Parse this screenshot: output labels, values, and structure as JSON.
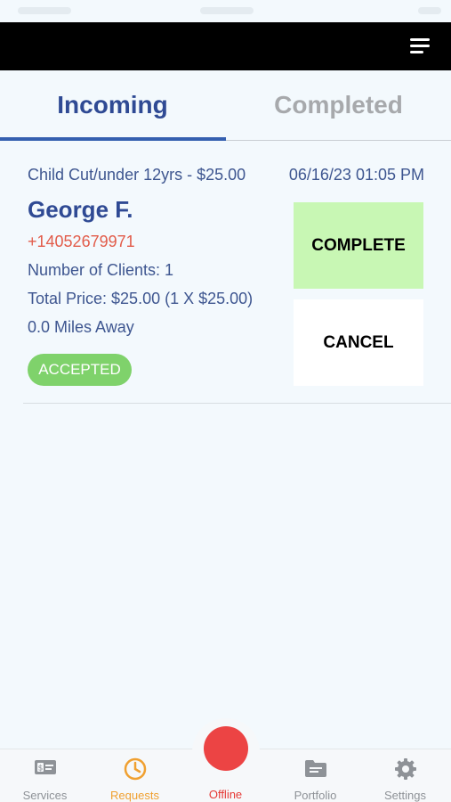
{
  "tabs": {
    "incoming": "Incoming",
    "completed": "Completed",
    "active": "incoming"
  },
  "request": {
    "service": "Child Cut/under 12yrs - $25.00",
    "datetime": "06/16/23 01:05 PM",
    "client_name": "George F.",
    "phone": "+14052679971",
    "clients": "Number of Clients: 1",
    "total_price": "Total Price: $25.00 (1 X $25.00)",
    "distance": "0.0 Miles Away",
    "status": "ACCEPTED"
  },
  "actions": {
    "complete": "COMPLETE",
    "cancel": "CANCEL"
  },
  "bottom_nav": {
    "services": "Services",
    "requests": "Requests",
    "offline": "Offline",
    "portfolio": "Portfolio",
    "settings": "Settings",
    "active": "requests"
  },
  "colors": {
    "accent": "#2f4a94",
    "complete_bg": "#c8f7b4",
    "status_badge": "#7fd26b",
    "offline": "#ec4444",
    "active_nav": "#f0a030"
  },
  "icons": {
    "menu": "menu-icon",
    "services": "money-icon",
    "requests": "clock-icon",
    "portfolio": "folder-icon",
    "settings": "gear-icon"
  }
}
